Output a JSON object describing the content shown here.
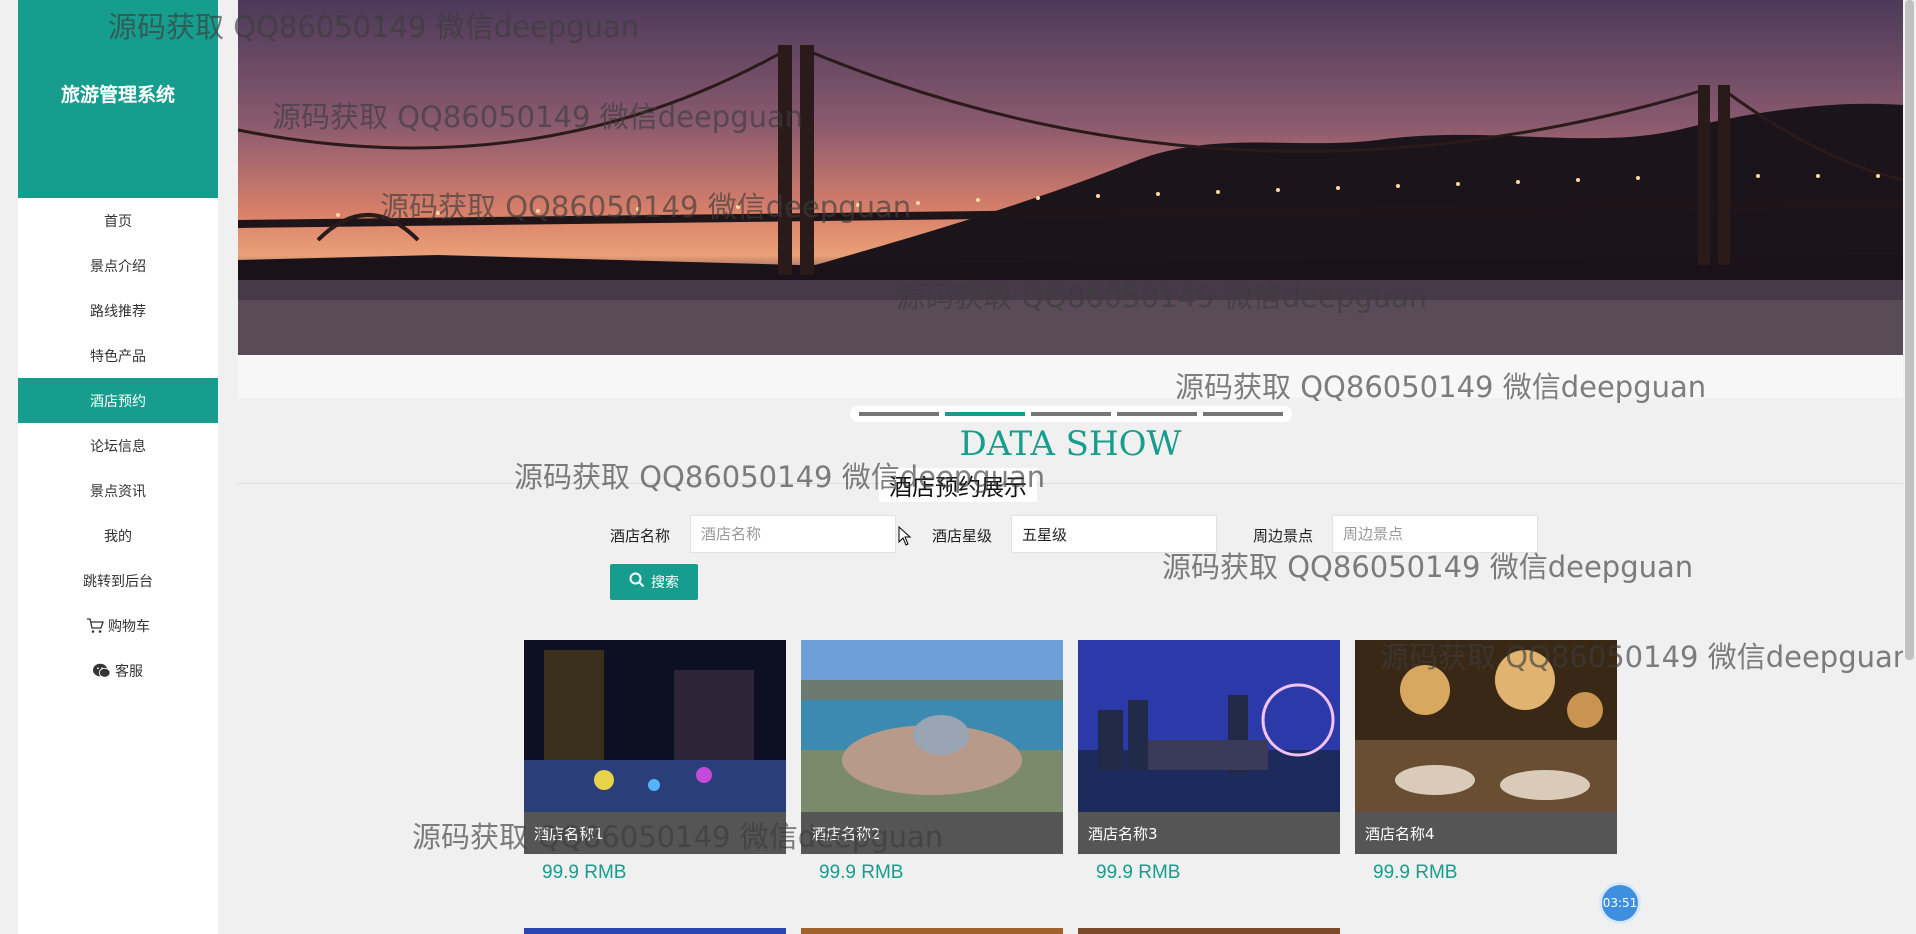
{
  "sidebar": {
    "brand": "旅游管理系统",
    "items": [
      {
        "label": "首页"
      },
      {
        "label": "景点介绍"
      },
      {
        "label": "路线推荐"
      },
      {
        "label": "特色产品"
      },
      {
        "label": "酒店预约"
      },
      {
        "label": "论坛信息"
      },
      {
        "label": "景点资讯"
      },
      {
        "label": "我的"
      },
      {
        "label": "跳转到后台"
      },
      {
        "label": "购物车",
        "icon": "cart-icon"
      },
      {
        "label": "客服",
        "icon": "wechat-icon"
      }
    ],
    "active_index": 4
  },
  "banner": {
    "carousel_count": 5,
    "active_slide": 2
  },
  "section": {
    "title": "DATA SHOW",
    "subtitle": "酒店预约展示"
  },
  "search": {
    "name_label": "酒店名称",
    "name_placeholder": "酒店名称",
    "name_value": "",
    "star_label": "酒店星级",
    "star_placeholder": "酒店星级",
    "star_value": "五星级",
    "nearby_label": "周边景点",
    "nearby_placeholder": "周边景点",
    "nearby_value": "",
    "button_label": "搜索"
  },
  "hotels": [
    {
      "name": "酒店名称1",
      "price": "99.9 RMB"
    },
    {
      "name": "酒店名称2",
      "price": "99.9 RMB"
    },
    {
      "name": "酒店名称3",
      "price": "99.9 RMB"
    },
    {
      "name": "酒店名称4",
      "price": "99.9 RMB"
    }
  ],
  "watermark": "源码获取 QQ86050149 微信deepguan",
  "timer": "03:51",
  "colors": {
    "accent": "#169d8e",
    "caption_bg": "#555555"
  }
}
